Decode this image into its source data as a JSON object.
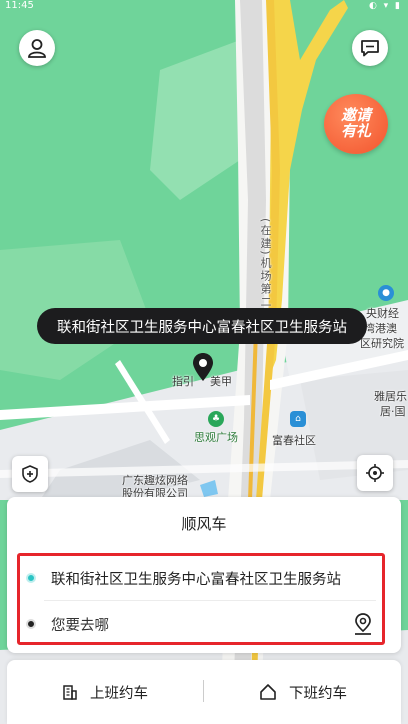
{
  "status_bar": {
    "time": "11:45",
    "icons": "◐ ▾ ▮"
  },
  "promo": {
    "line1": "邀请",
    "line2": "有礼"
  },
  "map": {
    "labels": {
      "road_construction": "(在建)机场第二通道",
      "guide": "指引",
      "beauty_shop": "美甲",
      "siguan_square": "思观广场",
      "fuchun_community": "富春社区",
      "company_line1": "广东趣炫网络",
      "company_line2": "股份有限公司",
      "research_line1": "央财经",
      "research_line2": "湾港澳",
      "research_line3": "区研究院",
      "yaju_line1": "雅居乐",
      "yaju_line2": "居·国"
    }
  },
  "tooltip": {
    "text": "联和街社区卫生服务中心富春社区卫生服务站"
  },
  "sheet": {
    "title": "顺风车",
    "start": "联和街社区卫生服务中心富春社区卫生服务站",
    "destination_placeholder": "您要去哪"
  },
  "commute": {
    "to_work": "上班约车",
    "off_work": "下班约车"
  },
  "colors": {
    "highlight_border": "#e6252b",
    "start_dot": "#2bc4c4",
    "tooltip_bg": "#1c1c1e",
    "map_green": "#6fd49a"
  }
}
